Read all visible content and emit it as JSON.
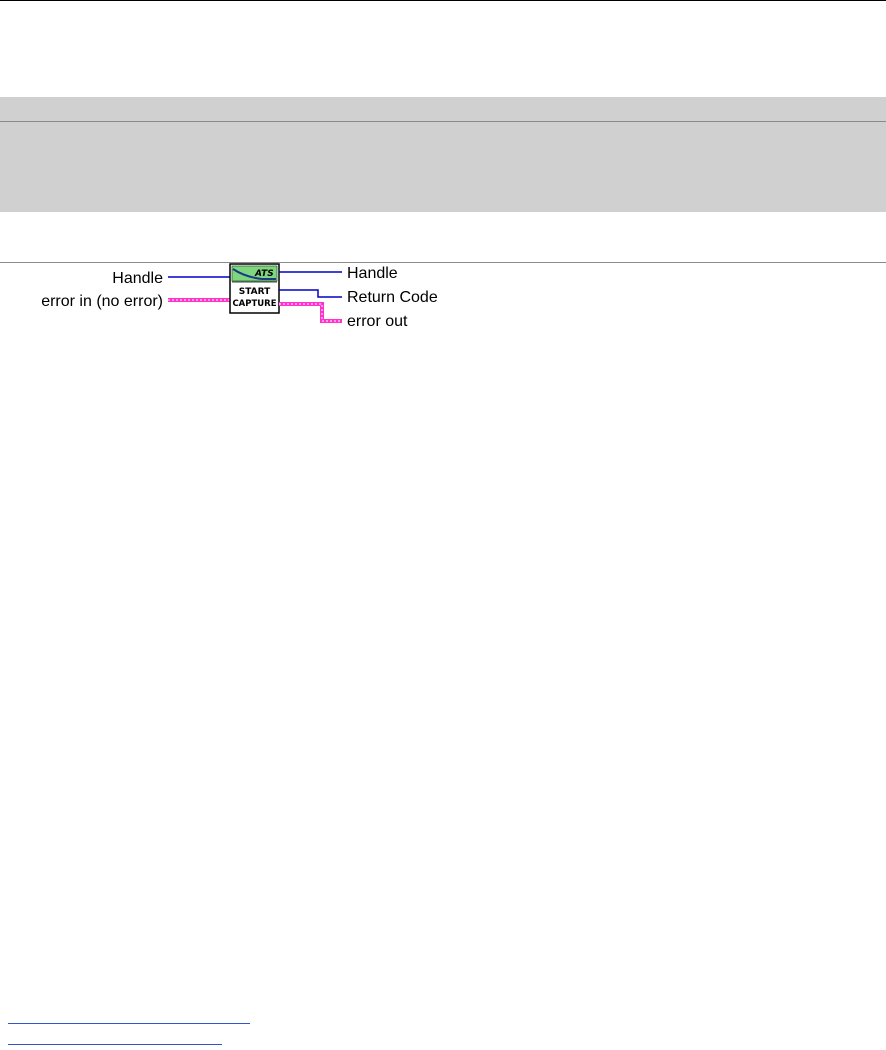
{
  "diagram": {
    "node": {
      "brand": "ATS",
      "line1": "START",
      "line2": "CAPTURE"
    },
    "inputs": {
      "handle": "Handle",
      "error_in": "error in (no error)"
    },
    "outputs": {
      "handle": "Handle",
      "return_code": "Return Code",
      "error_out": "error out"
    }
  },
  "colors": {
    "wire_int": "#0000cc",
    "wire_error": "#ff33cc",
    "band_gray": "#d0d0d0",
    "icon_green": "#7fd67f"
  }
}
